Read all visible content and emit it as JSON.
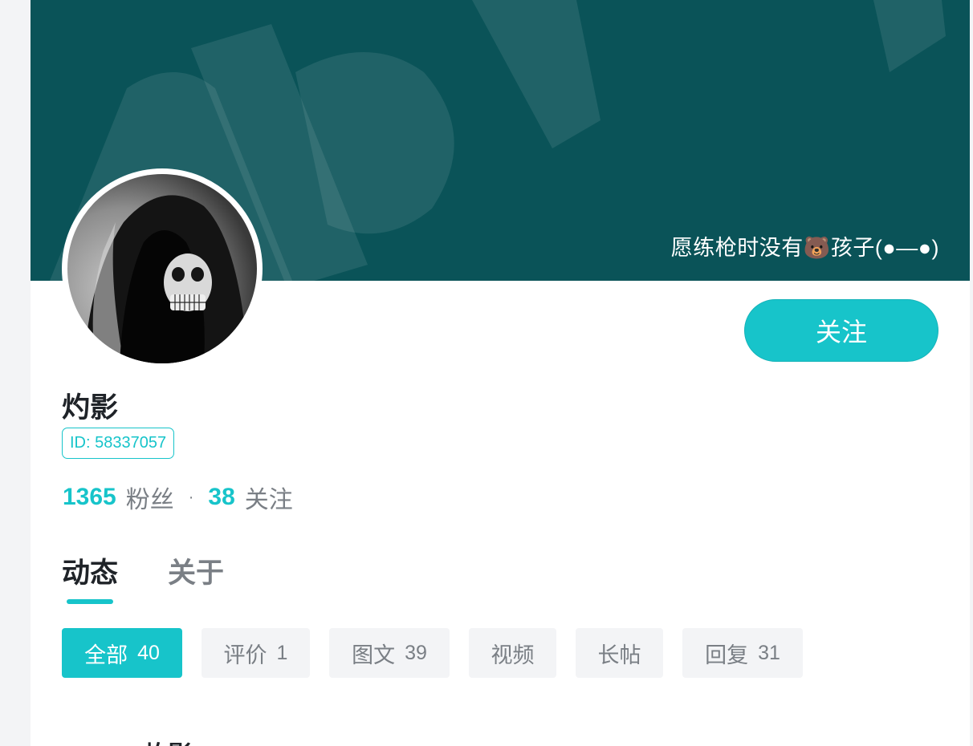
{
  "profile": {
    "signature": "愿练枪时没有🐻孩子(●—●)",
    "follow_label": "关注",
    "username": "灼影",
    "user_id": "ID: 58337057",
    "fans_count": "1365",
    "fans_label": "粉丝",
    "separator": "·",
    "following_count": "38",
    "following_label": "关注"
  },
  "tabs": {
    "active": "动态",
    "about": "关于"
  },
  "filters": [
    {
      "label": "全部",
      "count": "40",
      "active": true
    },
    {
      "label": "评价",
      "count": "1",
      "active": false
    },
    {
      "label": "图文",
      "count": "39",
      "active": false
    },
    {
      "label": "视频",
      "count": "",
      "active": false
    },
    {
      "label": "长帖",
      "count": "",
      "active": false
    },
    {
      "label": "回复",
      "count": "31",
      "active": false
    }
  ],
  "feed": {
    "first_post_author": "灼影"
  },
  "colors": {
    "accent": "#17c4ca",
    "banner": "#0a5358",
    "muted_text": "#7a7f85",
    "chip_bg": "#f3f4f6"
  },
  "icons": {
    "avatar": "hooded-skull-avatar",
    "banner_mark": "banner-watermark"
  }
}
